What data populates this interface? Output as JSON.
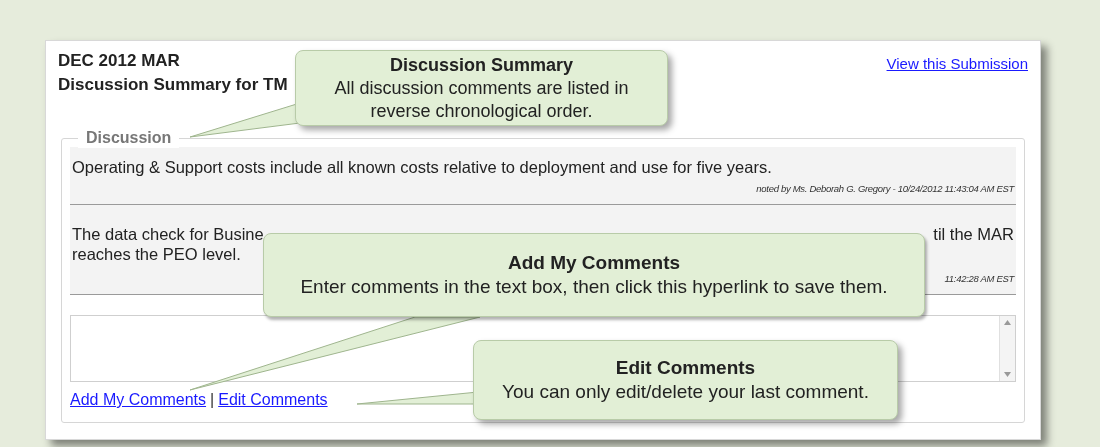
{
  "header": {
    "title": "DEC 2012 MAR",
    "subtitle": "Discussion Summary for TM",
    "link": "View this Submission"
  },
  "discussion": {
    "legend": "Discussion",
    "comments": [
      {
        "lines": [
          [
            "Operating & Support costs include all known costs relative to deployment and use for five years."
          ]
        ],
        "meta": "noted by Ms. Deborah G. Gregory - 10/24/2012 11:43:04 AM EST"
      },
      {
        "lines": [
          [
            "The data check for Busine",
            "til the MAR"
          ],
          [
            "reaches the PEO level."
          ]
        ],
        "meta": "11:42:28 AM EST"
      }
    ],
    "links": [
      "Add My Comments",
      "Edit Comments"
    ],
    "separator": "|"
  },
  "callouts": [
    {
      "title": "Discussion Summary",
      "text": "All discussion comments are listed in reverse chronological order."
    },
    {
      "title": "Add My Comments",
      "text": "Enter comments in the text box, then click this hyperlink to save them."
    },
    {
      "title": "Edit Comments",
      "text": "You can only edit/delete your last comment."
    }
  ]
}
